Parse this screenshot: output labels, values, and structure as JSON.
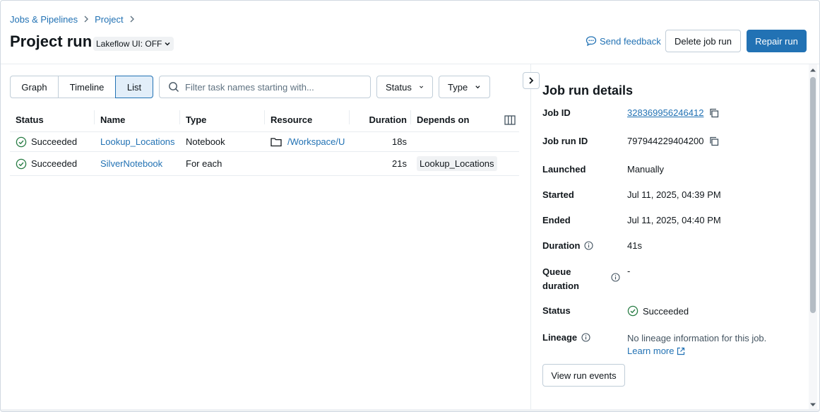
{
  "breadcrumb": {
    "items": [
      "Jobs & Pipelines",
      "Project"
    ]
  },
  "header": {
    "title": "Project run",
    "lakeflow_toggle": "Lakeflow UI: OFF",
    "feedback_label": "Send feedback",
    "delete_label": "Delete job run",
    "repair_label": "Repair run"
  },
  "toolbar": {
    "views": [
      "Graph",
      "Timeline",
      "List"
    ],
    "active_view": "List",
    "search_placeholder": "Filter task names starting with...",
    "search_value": "",
    "status_filter": "Status",
    "type_filter": "Type"
  },
  "table": {
    "columns": [
      "Status",
      "Name",
      "Type",
      "Resource",
      "Duration",
      "Depends on"
    ],
    "rows": [
      {
        "status": "Succeeded",
        "name": "Lookup_Locations",
        "type": "Notebook",
        "resource": "/Workspace/U",
        "duration": "18s",
        "depends_on": ""
      },
      {
        "status": "Succeeded",
        "name": "SilverNotebook",
        "type": "For each",
        "resource": "",
        "duration": "21s",
        "depends_on": "Lookup_Locations"
      }
    ]
  },
  "details": {
    "title": "Job run details",
    "job_id_label": "Job ID",
    "job_id": "328369956246412",
    "job_run_id_label": "Job run ID",
    "job_run_id": "797944229404200",
    "launched_label": "Launched",
    "launched": "Manually",
    "started_label": "Started",
    "started": "Jul 11, 2025, 04:39 PM",
    "ended_label": "Ended",
    "ended": "Jul 11, 2025, 04:40 PM",
    "duration_label": "Duration",
    "duration": "41s",
    "queue_label": "Queue duration",
    "queue_duration": "-",
    "status_label": "Status",
    "status": "Succeeded",
    "lineage_label": "Lineage",
    "lineage_text": "No lineage information for this job.",
    "learn_more": "Learn more",
    "view_events_label": "View run events"
  },
  "colors": {
    "accent": "#2272b4",
    "success": "#3ba65e",
    "border": "#c0cdd8"
  },
  "icons": [
    "chevron-right-icon",
    "chevron-down-icon",
    "feedback-icon",
    "search-icon",
    "success-check-icon",
    "folder-icon",
    "columns-icon",
    "copy-icon",
    "info-icon",
    "external-link-icon",
    "panel-collapse-icon"
  ]
}
